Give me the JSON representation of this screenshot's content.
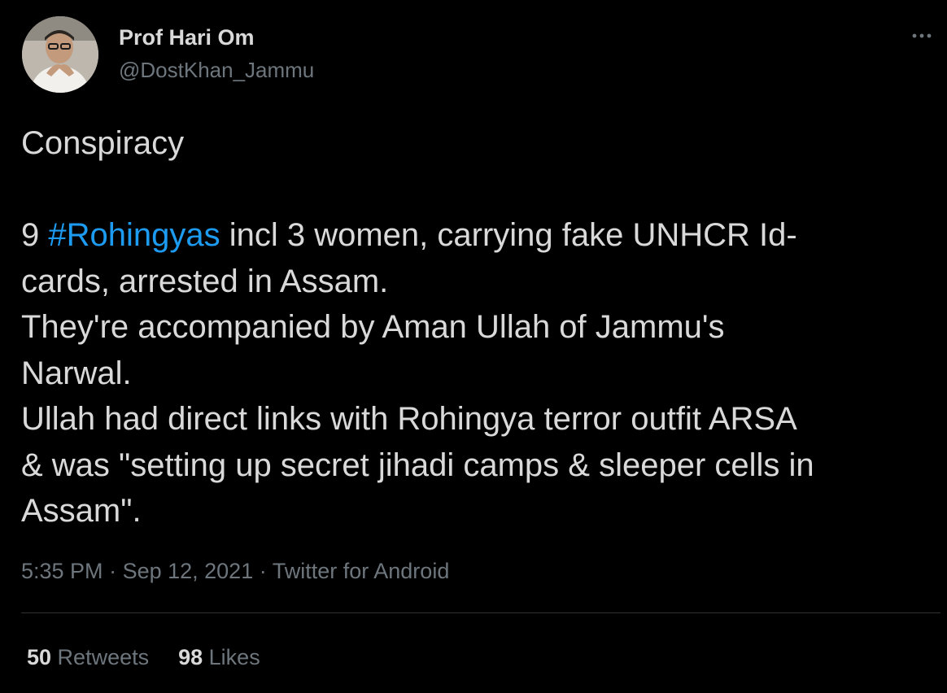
{
  "author": {
    "display_name": "Prof Hari Om",
    "handle": "@DostKhan_Jammu"
  },
  "more_icon": "more-horizontal-icon",
  "tweet": {
    "line1": "Conspiracy",
    "line2_pre": "9 ",
    "hashtag": "#Rohingyas",
    "line2_post": " incl 3 women, carrying fake UNHCR Id-",
    "line3": "cards, arrested in Assam.",
    "line4": "They're accompanied by Aman Ullah of Jammu's",
    "line5": "Narwal.",
    "line6": "Ullah had direct links with Rohingya terror outfit ARSA",
    "line7": "& was \"setting up secret jihadi camps & sleeper cells in",
    "line8": "Assam\"."
  },
  "meta": {
    "time": "5:35 PM",
    "separator": " · ",
    "date": "Sep 12, 2021",
    "source": "Twitter for Android"
  },
  "stats": {
    "retweets_count": "50",
    "retweets_label": " Retweets",
    "likes_count": "98",
    "likes_label": " Likes"
  },
  "colors": {
    "background": "#000000",
    "text": "#d9d9d9",
    "secondary": "#6e767d",
    "accent": "#1d9bf0",
    "divider": "#2f3336"
  }
}
